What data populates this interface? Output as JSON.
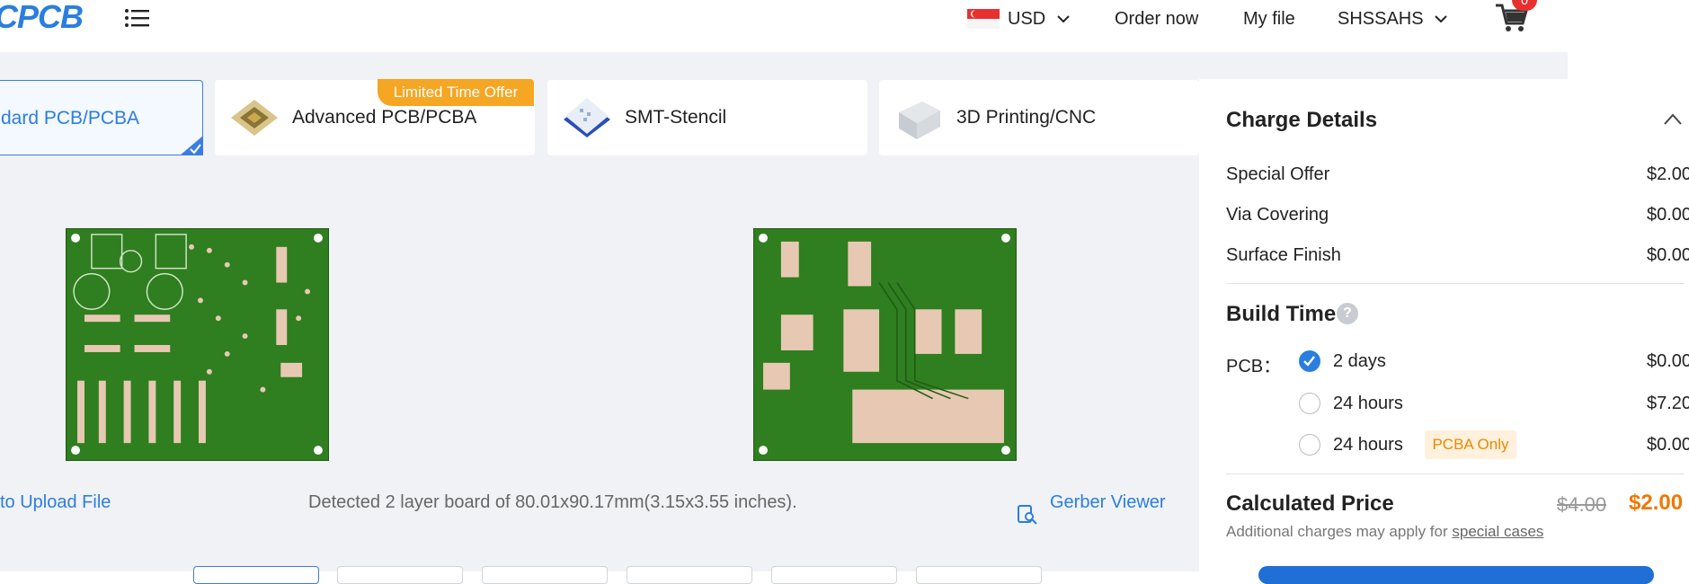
{
  "header": {
    "logo": "CPCB",
    "currency": "USD",
    "order_now": "Order now",
    "my_file": "My file",
    "account": "SHSSAHS",
    "cart_count": "0"
  },
  "products": [
    {
      "label": "dard PCB/PCBA",
      "active": true
    },
    {
      "label": "Advanced PCB/PCBA",
      "active": false
    },
    {
      "label": "SMT-Stencil",
      "active": false
    },
    {
      "label": "3D Printing/CNC",
      "active": false
    }
  ],
  "offer_badge": "Limited Time Offer",
  "upload": {
    "link": "to Upload File",
    "detected": "Detected 2 layer board of 80.01x90.17mm(3.15x3.55 inches).",
    "gerber_viewer": "Gerber Viewer"
  },
  "charges": {
    "title": "Charge Details",
    "items": [
      {
        "label": "Special Offer",
        "value": "$2.00"
      },
      {
        "label": "Via Covering",
        "value": "$0.00"
      },
      {
        "label": "Surface Finish",
        "value": "$0.00"
      }
    ]
  },
  "build_time": {
    "title": "Build Time",
    "help": "?",
    "pcb_label": "PCB：",
    "options": [
      {
        "label": "2 days",
        "value": "$0.00",
        "checked": true
      },
      {
        "label": "24 hours",
        "value": "$7.20",
        "checked": false
      },
      {
        "label": "24 hours",
        "value": "$0.00",
        "checked": false,
        "tag": "PCBA Only"
      }
    ]
  },
  "price": {
    "title": "Calculated Price",
    "old": "$4.00",
    "new": "$2.00",
    "note_prefix": "Additional charges may apply for ",
    "note_link": "special cases"
  },
  "colors": {
    "accent": "#2a7ee0",
    "offer": "#f5a623",
    "price": "#f07800",
    "board": "#2e7d1e"
  }
}
